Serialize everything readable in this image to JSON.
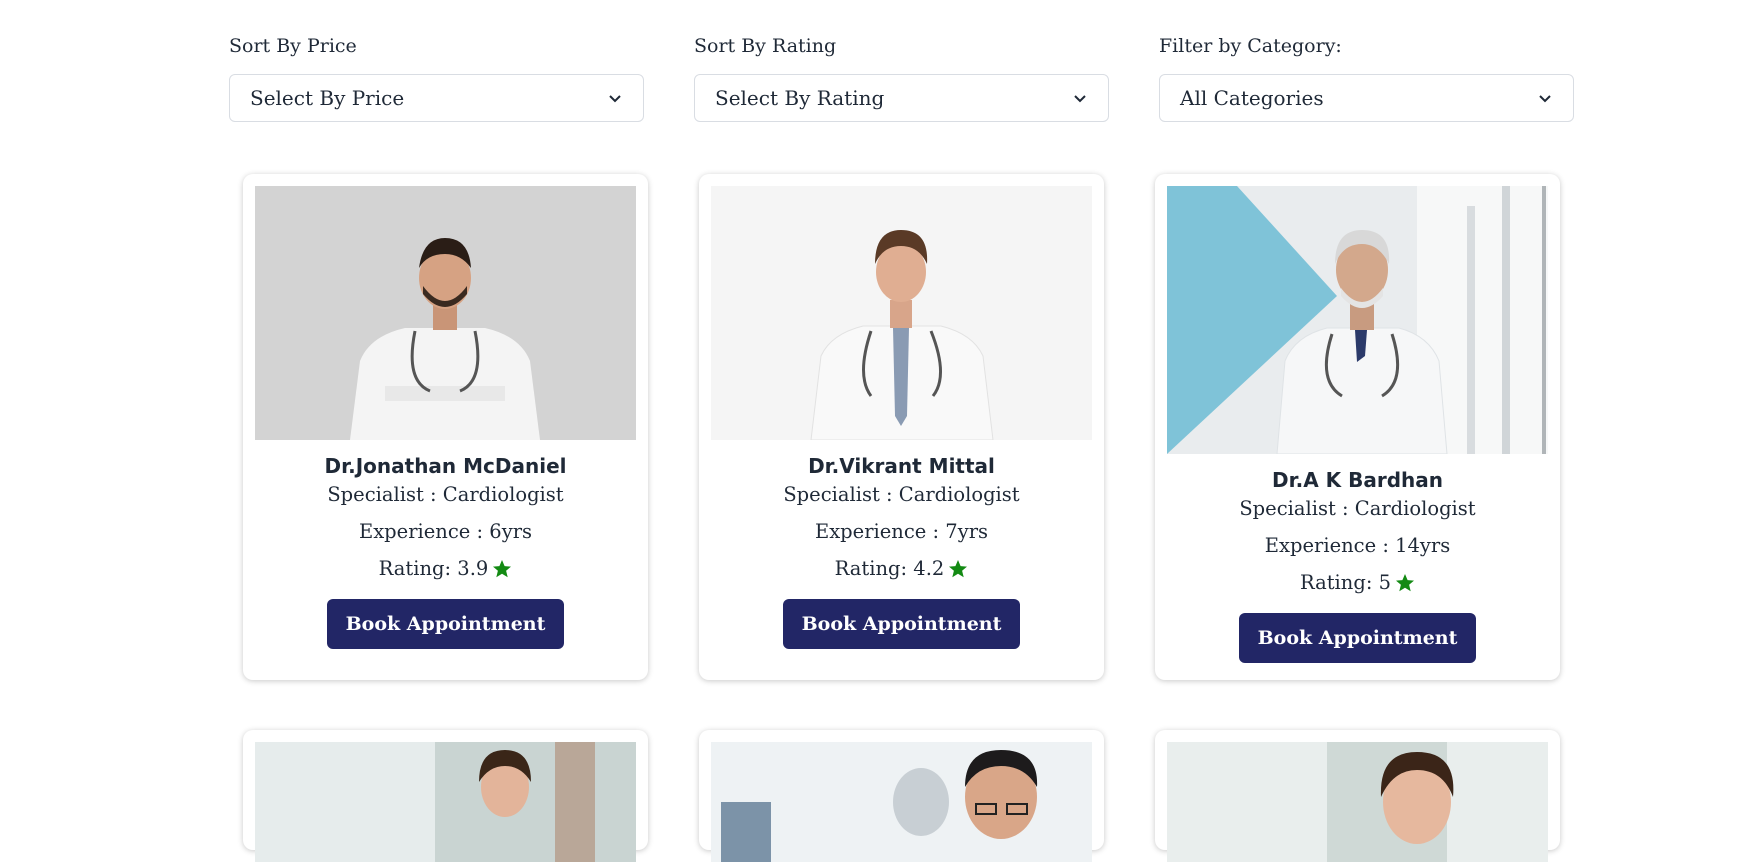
{
  "filters": {
    "price": {
      "label": "Sort By Price",
      "value": "Select By Price"
    },
    "rating": {
      "label": "Sort By Rating",
      "value": "Select By Rating"
    },
    "category": {
      "label": "Filter by Category:",
      "value": "All Categories"
    }
  },
  "doctors": [
    {
      "name": "Dr.Jonathan McDaniel",
      "specialist": "Specialist : Cardiologist",
      "experience": "Experience : 6yrs",
      "rating": "Rating: 3.9",
      "button": "Book Appointment"
    },
    {
      "name": "Dr.Vikrant Mittal",
      "specialist": "Specialist : Cardiologist",
      "experience": "Experience : 7yrs",
      "rating": "Rating: 4.2",
      "button": "Book Appointment"
    },
    {
      "name": "Dr.A K Bardhan",
      "specialist": "Specialist : Cardiologist",
      "experience": "Experience : 14yrs",
      "rating": "Rating: 5",
      "button": "Book Appointment"
    }
  ],
  "colors": {
    "button_bg": "#222666",
    "star": "#138a13",
    "card_shadow": "rgba(0,0,0,0.22)"
  },
  "icons": {
    "select_arrow": "chevron-down-icon",
    "rating": "star-icon"
  }
}
